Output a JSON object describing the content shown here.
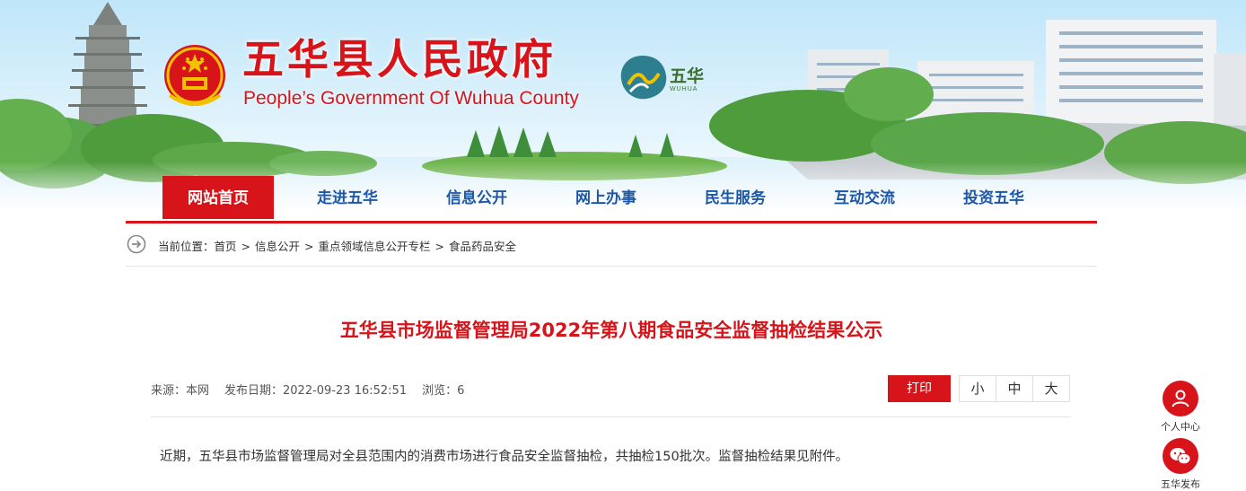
{
  "header": {
    "title": "五华县人民政府",
    "subtitle": "People’s Government Of Wuhua County",
    "logo_text": "五华",
    "logo_en": "WUHUA"
  },
  "nav": {
    "items": [
      {
        "label": "网站首页",
        "active": true
      },
      {
        "label": "走进五华",
        "active": false
      },
      {
        "label": "信息公开",
        "active": false
      },
      {
        "label": "网上办事",
        "active": false
      },
      {
        "label": "民生服务",
        "active": false
      },
      {
        "label": "互动交流",
        "active": false
      },
      {
        "label": "投资五华",
        "active": false
      }
    ]
  },
  "breadcrumb": {
    "prefix": "当前位置：",
    "items": [
      "首页",
      "信息公开",
      "重点领域信息公开专栏",
      "食品药品安全"
    ],
    "separator": ">"
  },
  "article": {
    "title": "五华县市场监督管理局2022年第八期食品安全监督抽检结果公示",
    "source": "来源：本网",
    "date": "发布日期：2022-09-23 16:52:51",
    "views": "浏览：6",
    "print_label": "打印",
    "font_sizes": [
      "小",
      "中",
      "大"
    ],
    "body": "近期，五华县市场监督管理局对全县范围内的消费市场进行食品安全监督抽检，共抽检150批次。监督抽检结果见附件。"
  },
  "side": {
    "personal_label": "个人中心",
    "wechat_label": "五华发布"
  },
  "colors": {
    "accent_red": "#d7141a",
    "nav_blue": "#1c57a8"
  }
}
